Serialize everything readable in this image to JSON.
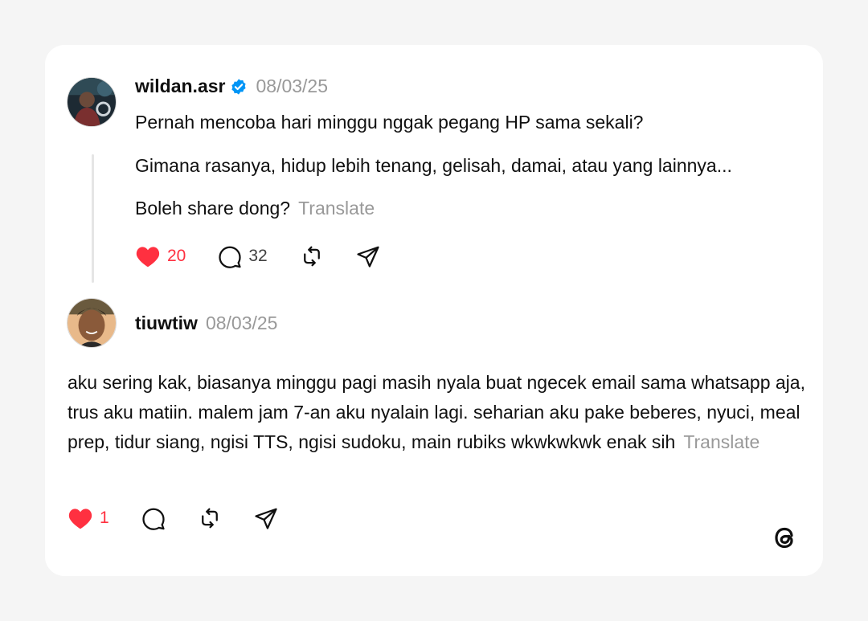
{
  "post": {
    "username": "wildan.asr",
    "verified": true,
    "date": "08/03/25",
    "lines": [
      "Pernah mencoba hari minggu nggak pegang HP sama sekali?",
      "Gimana rasanya, hidup lebih tenang, gelisah, damai, atau yang lainnya...",
      "Boleh share dong?"
    ],
    "translate_label": "Translate",
    "likes": "20",
    "replies": "32",
    "liked": true
  },
  "reply": {
    "username": "tiuwtiw",
    "date": "08/03/25",
    "text": "aku sering kak, biasanya minggu pagi masih nyala buat ngecek email sama whatsapp aja, trus aku matiin. malem jam 7-an aku nyalain lagi. seharian aku pake beberes, nyuci, meal prep, tidur siang, ngisi TTS, ngisi sudoku, main rubiks wkwkwkwk enak sih",
    "translate_label": "Translate",
    "likes": "1",
    "liked": true
  },
  "icons": {
    "like": "heart-icon",
    "reply": "speech-bubble-icon",
    "repost": "repost-icon",
    "share": "paper-plane-icon",
    "brand": "threads-logo-icon"
  },
  "colors": {
    "like": "#ff3040",
    "verified": "#0095f6",
    "muted": "#999999",
    "text": "#101010"
  }
}
